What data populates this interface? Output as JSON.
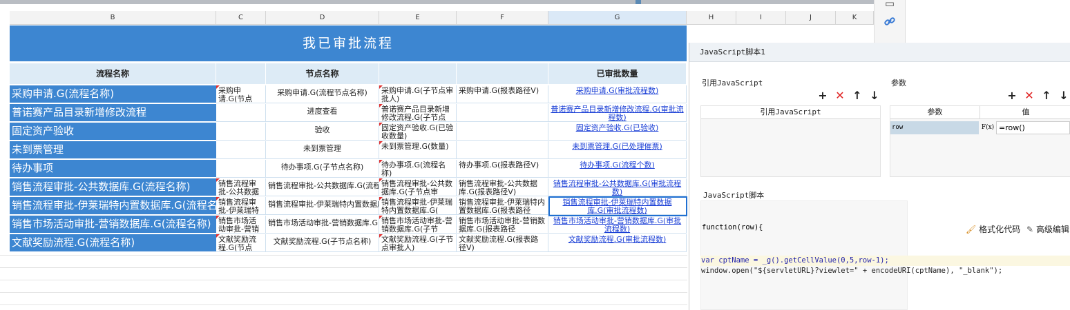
{
  "columns": [
    "B",
    "C",
    "D",
    "E",
    "F",
    "G",
    "H",
    "I",
    "J",
    "K"
  ],
  "banner": "我已审批流程",
  "headers": {
    "name": "流程名称",
    "node": "节点名称",
    "approved": "已审批数量"
  },
  "rows": [
    {
      "name": "采购申请.G(流程名称)",
      "c": "采购申请.G(节点ID)",
      "d": "采购申请.G(流程节点名称)",
      "e": "采购申请.G(子节点审批人)",
      "f": "采购申请.G(报表路径V)",
      "g": "采购申请.G(审批流程数)"
    },
    {
      "name": "普诺赛产品目录新增修改流程",
      "c": "",
      "d": "进度查看",
      "e": "普诺赛产品目录新增修改流程.G(子节点",
      "f": "",
      "g": "普诺赛产品目录新增修改流程.G(审批流程数)"
    },
    {
      "name": "固定资产验收",
      "c": "",
      "d": "验收",
      "e": "固定资产验收.G(已验收数量)",
      "f": "",
      "g": "固定资产验收.G(已验收)"
    },
    {
      "name": "未到票管理",
      "c": "",
      "d": "未到票管理",
      "e": "未到票管理.G(数量)",
      "f": "",
      "g": "未到票管理.G(已处理催票)"
    },
    {
      "name": "待办事项",
      "c": "",
      "d": "待办事项.G(子节点名称)",
      "e": "待办事项.G(流程名称)",
      "f": "待办事项.G(报表路径V)",
      "g": "待办事项.G(流程个数)"
    },
    {
      "name": "销售流程审批-公共数据库.G(流程名称)",
      "c": "销售流程审批-公共数据",
      "d": "销售流程审批-公共数据库.G(流程节点名称)",
      "e": "销售流程审批-公共数据库.G(子节点审",
      "f": "销售流程审批-公共数据库.G(报表路径V)",
      "g": "销售流程审批-公共数据库.G(审批流程数)"
    },
    {
      "name": "销售流程审批-伊莱瑞特内置数据库.G(流程名称)",
      "c": "销售流程审批-伊莱瑞特",
      "d": "销售流程审批-伊莱瑞特内置数据库.G(流程节点名称)",
      "e": "销售流程审批-伊莱瑞特内置数据库.G(",
      "f": "销售流程审批-伊莱瑞特内置数据库.G(报表路径",
      "g": "销售流程审批-伊莱瑞特内置数据库.G(审批流程数)"
    },
    {
      "name": "销售市场活动审批-营销数据库.G(流程名称)",
      "c": "销售市场活动审批-营销",
      "d": "销售市场活动审批-营销数据库.G(流程节点名称)",
      "e": "销售市场活动审批-营销数据库.G(子节",
      "f": "销售市场活动审批-营销数据库.G(报表路径",
      "g": "销售市场活动审批-营销数据库.G(审批流程数)"
    },
    {
      "name": "文献奖励流程.G(流程名称)",
      "c": "文献奖励流程.G(节点ID)",
      "d": "文献奖励流程.G(子节点名称)",
      "e": "文献奖励流程.G(子节点审批人)",
      "f": "文献奖励流程.G(报表路径V)",
      "g": "文献奖励流程.G(审批流程数)"
    }
  ],
  "dialog": {
    "title": "JavaScript脚本1",
    "ref_js_label": "引用JavaScript",
    "params_label": "参数",
    "ref_js_col": "引用JavaScript",
    "param_col": "参数",
    "value_col": "值",
    "param_name": "row",
    "fx": "F(x)",
    "param_value": "=row()",
    "script_label": "JavaScript脚本",
    "func_sig": "function(row){",
    "format_btn": "格式化代码",
    "advanced_btn": "高级编辑",
    "code_line1": "var cptName = _g().getCellValue(0,5,row-1);",
    "code_line2": "window.open(\"${servletURL}?viewlet=\" + encodeURI(cptName), \"_blank\");"
  }
}
